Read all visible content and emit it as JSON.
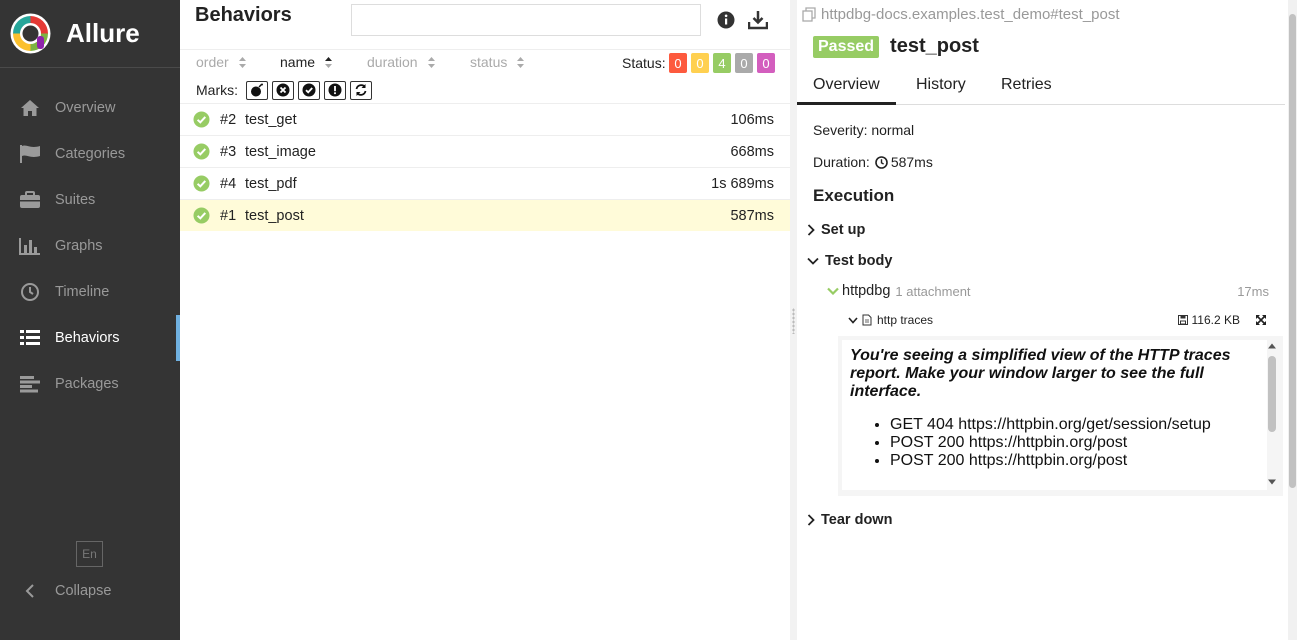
{
  "app": {
    "name": "Allure"
  },
  "sidebar": {
    "items": [
      {
        "label": "Overview",
        "icon": "home-icon",
        "active": false
      },
      {
        "label": "Categories",
        "icon": "flag-icon",
        "active": false
      },
      {
        "label": "Suites",
        "icon": "briefcase-icon",
        "active": false
      },
      {
        "label": "Graphs",
        "icon": "bar-chart-icon",
        "active": false
      },
      {
        "label": "Timeline",
        "icon": "clock-icon",
        "active": false
      },
      {
        "label": "Behaviors",
        "icon": "list-icon",
        "active": true
      },
      {
        "label": "Packages",
        "icon": "align-left-icon",
        "active": false
      }
    ],
    "language": "En",
    "collapse_label": "Collapse"
  },
  "behaviors": {
    "title": "Behaviors",
    "search": {
      "value": "",
      "placeholder": ""
    },
    "sort_columns": [
      "order",
      "name",
      "duration",
      "status"
    ],
    "active_sort": "name",
    "status_label": "Status:",
    "status_counts": [
      {
        "count": "0",
        "color": "#fd5a3e",
        "status": "failed"
      },
      {
        "count": "0",
        "color": "#ffd050",
        "status": "broken"
      },
      {
        "count": "4",
        "color": "#97cc64",
        "status": "passed"
      },
      {
        "count": "0",
        "color": "#aaaaaa",
        "status": "skipped"
      },
      {
        "count": "0",
        "color": "#d35ebe",
        "status": "unknown"
      }
    ],
    "marks_label": "Marks:",
    "marks": [
      "flaky-icon",
      "new-failed-icon",
      "new-passed-icon",
      "new-broken-icon",
      "retries-status-change-icon"
    ],
    "rows": [
      {
        "order": "#2",
        "name": "test_get",
        "duration": "106ms",
        "selected": false
      },
      {
        "order": "#3",
        "name": "test_image",
        "duration": "668ms",
        "selected": false
      },
      {
        "order": "#4",
        "name": "test_pdf",
        "duration": "1s 689ms",
        "selected": false
      },
      {
        "order": "#1",
        "name": "test_post",
        "duration": "587ms",
        "selected": true
      }
    ]
  },
  "testcase": {
    "path": "httpdbg-docs.examples.test_demo#test_post",
    "status": "Passed",
    "name": "test_post",
    "tabs": [
      "Overview",
      "History",
      "Retries"
    ],
    "active_tab": "Overview",
    "severity": "Severity: normal",
    "duration_label": "Duration:",
    "duration": "587ms",
    "execution_title": "Execution",
    "setup_label": "Set up",
    "body_label": "Test body",
    "step": {
      "name": "httpdbg",
      "attachments": "1 attachment",
      "duration": "17ms"
    },
    "attachment": {
      "name": "http traces",
      "size": "116.2 KB"
    },
    "trace_note": "You're seeing a simplified view of the HTTP traces report. Make your window larger to see the full interface.",
    "trace_requests": [
      "GET 404 https://httpbin.org/get/session/setup",
      "POST 200 https://httpbin.org/post",
      "POST 200 https://httpbin.org/post"
    ],
    "teardown_label": "Tear down"
  }
}
